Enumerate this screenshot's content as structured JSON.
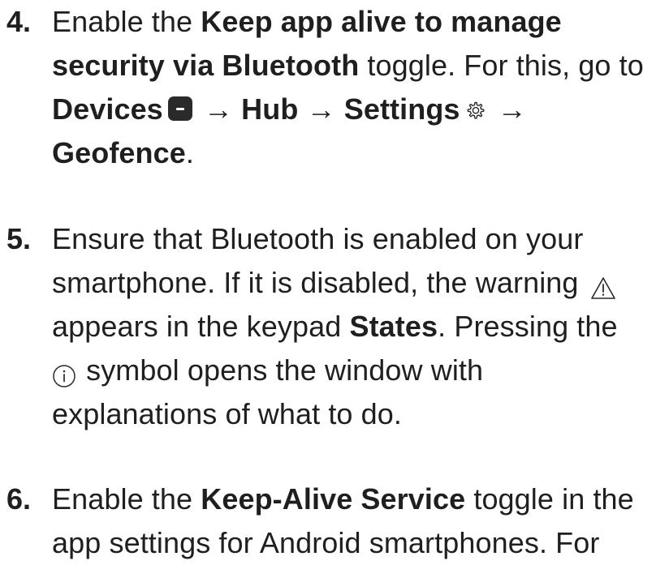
{
  "steps": [
    {
      "number": "4.",
      "line1_pre": "Enable the ",
      "line1_bold": "Keep app alive to manage",
      "line2_bold": "security via Bluetooth",
      "line2_post": " toggle. For this, go to",
      "line3_devices": "Devices",
      "line3_arrow1": " → ",
      "line3_hub": "Hub",
      "line3_arrow2": " → ",
      "line3_settings": "Settings",
      "line3_arrow3": " →",
      "line4_geofence": "Geofence",
      "line4_post": "."
    },
    {
      "number": "5.",
      "line1": "Ensure that Bluetooth is enabled on your",
      "line2": "smartphone. If it is disabled, the warning ",
      "line3_pre": "appears in the keypad ",
      "line3_bold": "States",
      "line3_post": ". Pressing the",
      "line4_post": " symbol opens the window with",
      "line5": "explanations of what to do."
    },
    {
      "number": "6.",
      "line1_pre": "Enable the ",
      "line1_bold": "Keep-Alive Service",
      "line1_post": " toggle in the",
      "line2": "app settings for Android smartphones. For"
    }
  ],
  "icons": {
    "devices": "devices-icon",
    "settings": "gear-icon",
    "warning": "warning-icon",
    "info": "info-icon"
  },
  "colors": {
    "text": "#1f1f1f",
    "icon_fill": "#2a2a2a"
  }
}
